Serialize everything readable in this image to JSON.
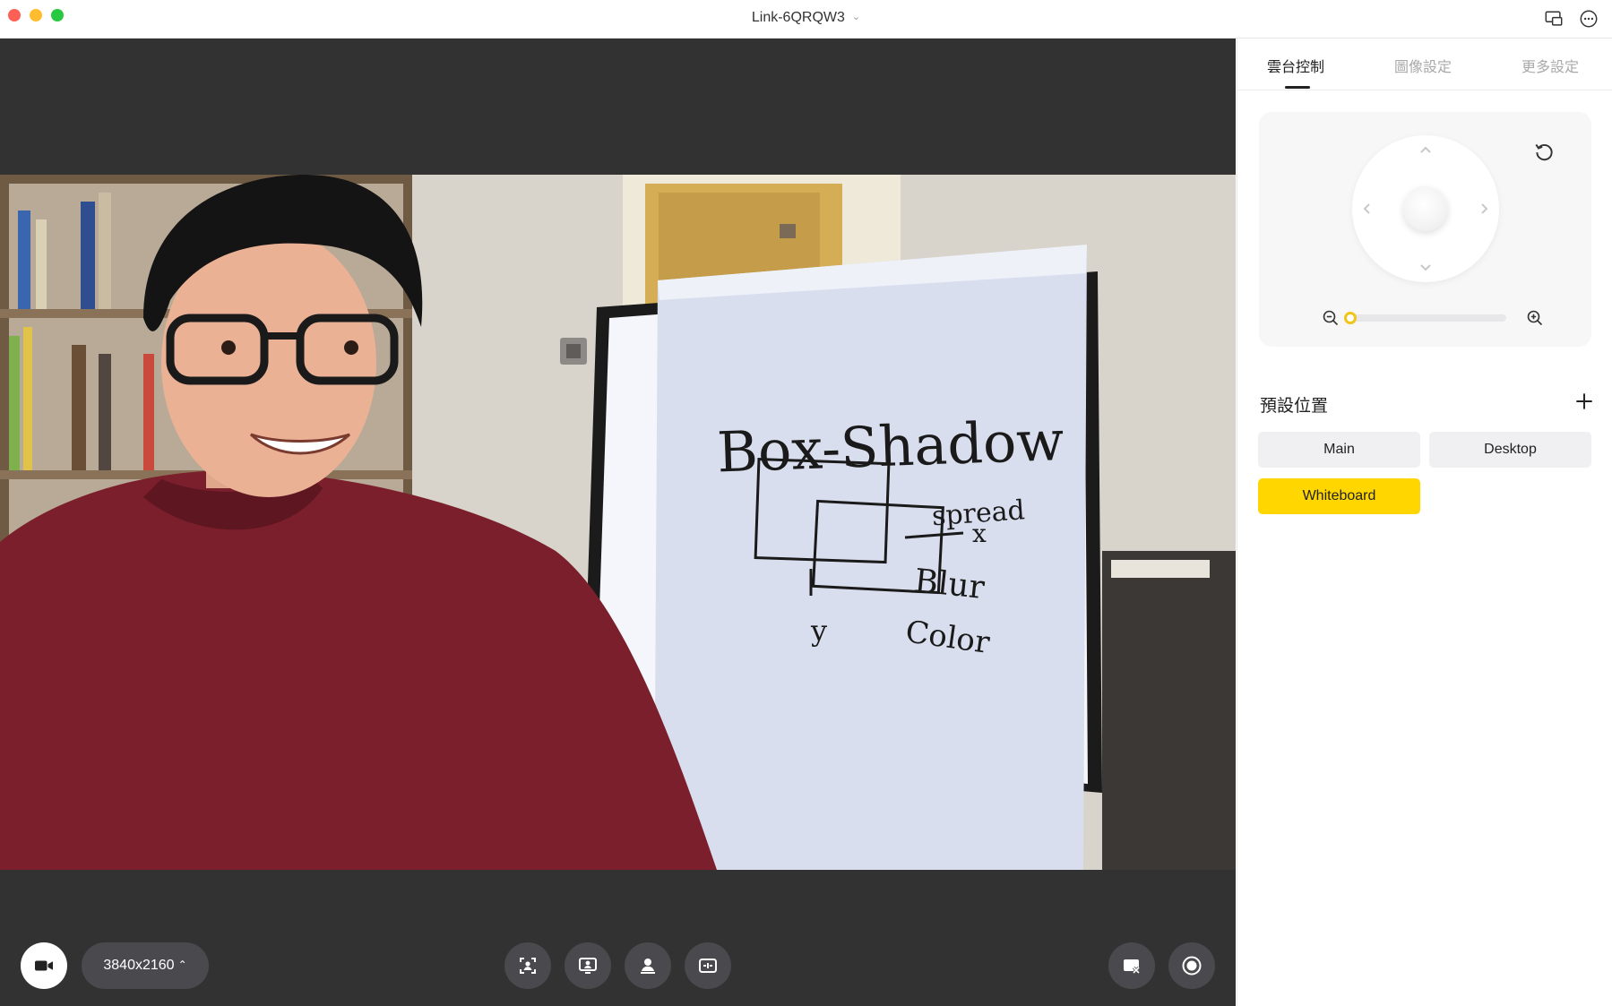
{
  "window": {
    "title": "Link-6QRQW3"
  },
  "toolbar": {
    "resolution": "3840x2160",
    "buttons": [
      {
        "icon": "camera-icon"
      },
      {
        "icon": "auto-framing-icon"
      },
      {
        "icon": "tracking-icon"
      },
      {
        "icon": "presenter-mode-icon"
      },
      {
        "icon": "desk-mode-icon"
      },
      {
        "icon": "privacy-mode-icon"
      },
      {
        "icon": "record-icon"
      }
    ]
  },
  "video": {
    "whiteboard_text": [
      "Box-Shadow",
      "spread",
      "x",
      "Blur",
      "y",
      "Color"
    ]
  },
  "sidebar": {
    "tabs": [
      {
        "label": "雲台控制",
        "active": true
      },
      {
        "label": "圖像設定",
        "active": false
      },
      {
        "label": "更多設定",
        "active": false
      }
    ],
    "ptz": {
      "zoom_level": 0.0
    },
    "presets": {
      "title": "預設位置",
      "items": [
        {
          "label": "Main",
          "active": false
        },
        {
          "label": "Desktop",
          "active": false
        },
        {
          "label": "Whiteboard",
          "active": true
        }
      ]
    }
  },
  "colors": {
    "accent": "#ffd600",
    "stage": "#323232",
    "button": "#4a4a4e"
  }
}
